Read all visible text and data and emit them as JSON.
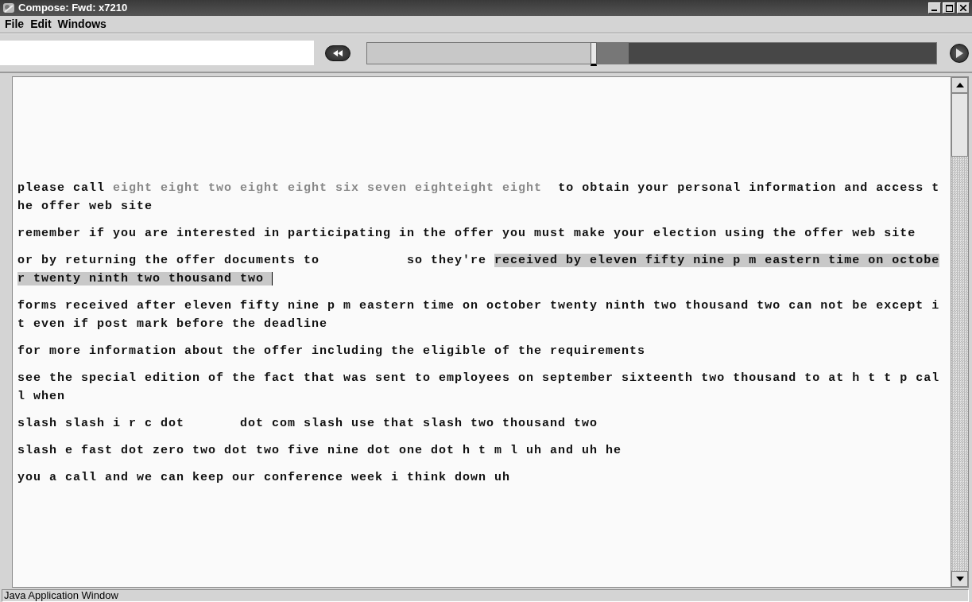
{
  "window": {
    "title": "Compose: Fwd: x7210"
  },
  "menu": [
    "File",
    "Edit",
    "Windows"
  ],
  "player": {
    "level": 0.42
  },
  "paragraphs": [
    {
      "lines": [
        [
          {
            "kind": "plain",
            "text": "please call "
          },
          {
            "kind": "dim",
            "text": "eight eight two eight eight six seven eight"
          },
          {
            "kind": "dim",
            "text": "eight eight"
          },
          {
            "kind": "plain",
            "text": "  to obtain your personal information and access t"
          }
        ],
        [
          {
            "kind": "plain",
            "text": "he offer web site"
          }
        ]
      ]
    },
    {
      "lines": [
        [
          {
            "kind": "plain",
            "text": "remember if you are interested in participating in the offer you must make your election using the offer web site"
          }
        ]
      ]
    },
    {
      "lines": [
        [
          {
            "kind": "plain",
            "text": "or by returning the offer documents to           so they're "
          },
          {
            "kind": "selected",
            "text": "received by eleven fifty nine p m eastern time on octobe"
          }
        ],
        [
          {
            "kind": "selected",
            "text": "r twenty ninth two thousand two "
          }
        ]
      ]
    },
    {
      "lines": [
        [
          {
            "kind": "plain",
            "text": "forms received after eleven fifty nine p m eastern time on october twenty ninth two thousand two can not be except i"
          }
        ],
        [
          {
            "kind": "plain",
            "text": "t even if post mark before the deadline"
          }
        ]
      ]
    },
    {
      "lines": [
        [
          {
            "kind": "plain",
            "text": "for more information about the offer including the eligible of the requirements"
          }
        ]
      ]
    },
    {
      "lines": [
        [
          {
            "kind": "plain",
            "text": "see the special edition of the fact that was sent to employees on september sixteenth two thousand to at h t t p cal"
          }
        ],
        [
          {
            "kind": "plain",
            "text": "l when"
          }
        ]
      ]
    },
    {
      "lines": [
        [
          {
            "kind": "plain",
            "text": "slash slash i r c dot       dot com slash use that slash two thousand two"
          }
        ]
      ]
    },
    {
      "lines": [
        [
          {
            "kind": "plain",
            "text": "slash e fast dot zero two dot two five nine dot one dot h t m l uh and uh he"
          }
        ]
      ]
    },
    {
      "lines": [
        [
          {
            "kind": "plain",
            "text": "you a call and we can keep our conference week i think down uh"
          }
        ]
      ]
    }
  ],
  "status_bar": "Java Application Window"
}
